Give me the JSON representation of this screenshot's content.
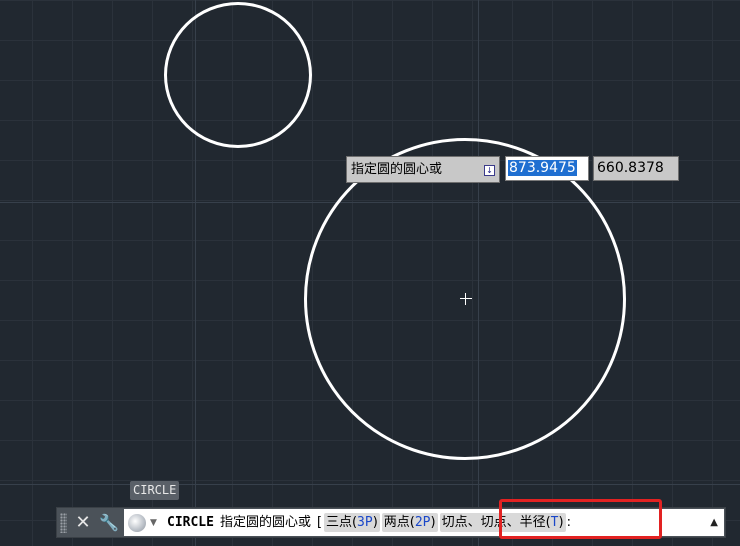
{
  "dynamic_input": {
    "prompt": "指定圆的圆心或",
    "arrow_icon": "down-arrow-icon",
    "x_value": "873.9475",
    "y_value": "660.8378"
  },
  "command_history_tag": "CIRCLE",
  "command_line": {
    "command": "CIRCLE",
    "prompt": "指定圆的圆心或",
    "open_bracket": "[",
    "options": [
      {
        "label": "三点(",
        "key": "3P",
        "close": ")"
      },
      {
        "label": "两点(",
        "key": "2P",
        "close": ")"
      },
      {
        "label": "切点、切点、半径(",
        "key": "T",
        "close": ")"
      }
    ],
    "suffix": ":",
    "close_icon": "✕",
    "settings_icon": "🔧",
    "history_icon": "▲"
  },
  "colors": {
    "canvas": "#212830",
    "highlight": "#e22222",
    "option_key": "#1a47c9"
  }
}
